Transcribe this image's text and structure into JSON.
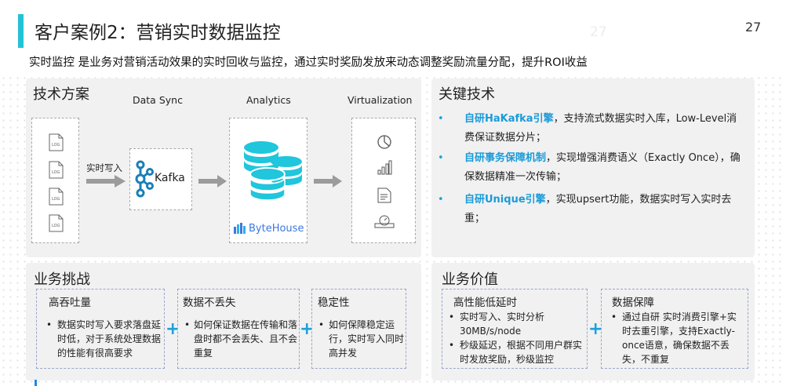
{
  "header": {
    "title": "客户案例2：营销实时数据监控",
    "page_number": "27",
    "page_number_ghost": "27",
    "subtitle": "实时监控 是业务对营销活动效果的实时回收与监控，通过实时奖励发放来动态调整奖励流量分配，提升ROI收益"
  },
  "tech_panel": {
    "title": "技术方案",
    "stage_data_sync": "Data Sync",
    "stage_analytics": "Analytics",
    "stage_virtualization": "Virtualization",
    "log_label": "LOG",
    "arrow_label": "实时写入",
    "kafka_label": "Kafka",
    "bytehouse_label": "ByteHouse",
    "viz_icons": [
      "pie-chart-icon",
      "bar-chart-icon",
      "report-icon",
      "dashboard-icon"
    ]
  },
  "key_panel": {
    "title": "关键技术",
    "items": [
      {
        "highlight": "自研HaKafka引擎",
        "text": "，支持流式数据实时入库，Low-Level消费保证数据分片；"
      },
      {
        "highlight": "自研事务保障机制",
        "text": "，实现增强消费语义（Exactly Once），确保数据精准一次传输；"
      },
      {
        "highlight": "自研Unique引擎",
        "text": "，实现upsert功能，数据实时写入实时去重；"
      }
    ]
  },
  "challenge_panel": {
    "title": "业务挑战",
    "cards": [
      {
        "title": "高吞吐量",
        "text": "数据实时写入要求落盘延时低，对于系统处理数据的性能有很高要求"
      },
      {
        "title": "数据不丢失",
        "text": "如何保证数据在传输和落盘时都不会丢失、且不会重复"
      },
      {
        "title": "稳定性",
        "text": "如何保障稳定运行，实时写入同时高并发"
      }
    ]
  },
  "value_panel": {
    "title": "业务价值",
    "cards": [
      {
        "title": "高性能低延时",
        "bullets": [
          "实时写入、实时分析30MB/s/node",
          "秒级延迟，根据不同用户群实时发放奖励，秒级监控"
        ]
      },
      {
        "title": "数据保障",
        "bullets": [
          "通过自研 实时消费引擎+实时去重引擎，支持Exactly-once语意，确保数据不丢失，不重复"
        ]
      }
    ]
  },
  "colors": {
    "accent": "#22c2d6",
    "highlight": "#1b9bd8",
    "db_cyan": "#1fc6dc",
    "plus": "#1ea0dc",
    "panel_bg": "#f1f1f1"
  }
}
